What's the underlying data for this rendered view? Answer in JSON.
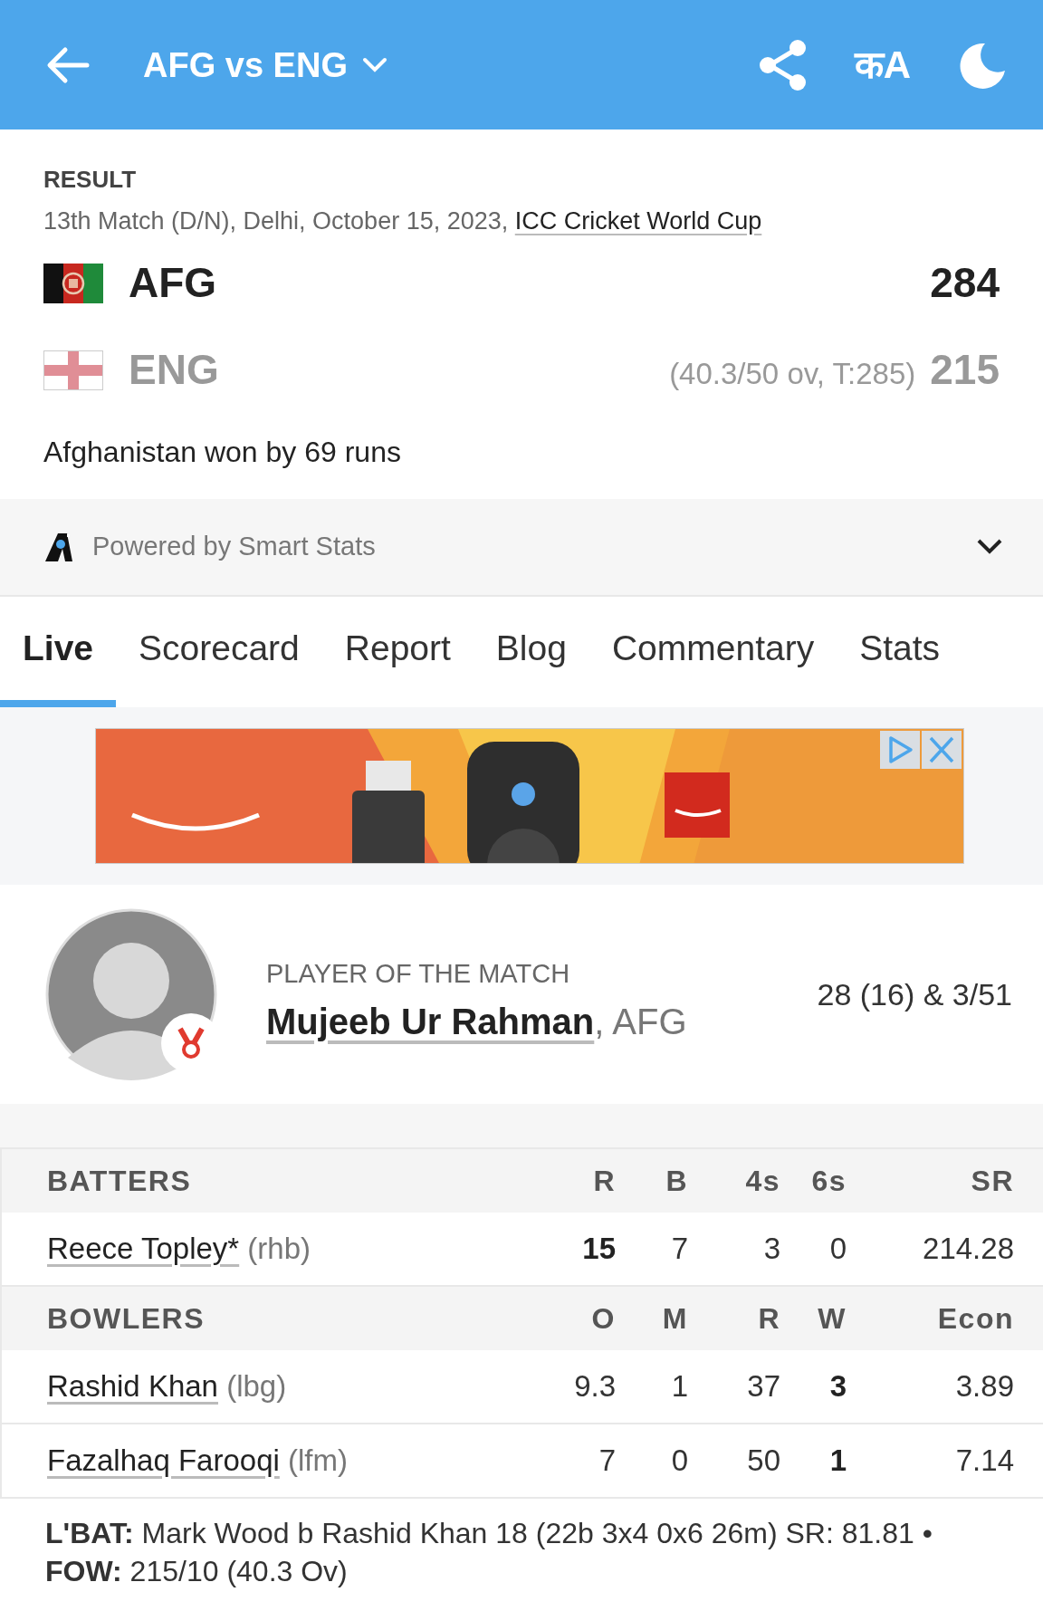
{
  "header": {
    "title": "AFG vs ENG",
    "language_toggle": "कA"
  },
  "result": {
    "status": "RESULT",
    "match_info": "13th Match (D/N), Delhi, October 15, 2023, ",
    "series_link": "ICC Cricket World Cup",
    "teams": [
      {
        "name": "AFG",
        "winner": true,
        "score": "284"
      },
      {
        "name": "ENG",
        "winner": false,
        "overs": "(40.3/50 ov, T:285)",
        "score": "215"
      }
    ],
    "summary": "Afghanistan won by 69 runs"
  },
  "smart_stats": {
    "label": "Powered by Smart Stats",
    "expanded": false
  },
  "tabs": [
    {
      "label": "Live",
      "selected": true
    },
    {
      "label": "Scorecard",
      "selected": false
    },
    {
      "label": "Report",
      "selected": false
    },
    {
      "label": "Blog",
      "selected": false
    },
    {
      "label": "Commentary",
      "selected": false
    },
    {
      "label": "Stats",
      "selected": false
    }
  ],
  "player_of_match": {
    "label": "PLAYER OF THE MATCH",
    "name": "Mujeeb Ur Rahman",
    "team": ", AFG",
    "figures": "28 (16) & 3/51"
  },
  "batters": {
    "columns": [
      "BATTERS",
      "R",
      "B",
      "4s",
      "6s",
      "SR"
    ],
    "rows": [
      {
        "cells": [
          {
            "text": "Reece Topley*",
            "note": " (rhb)",
            "bold": false
          },
          {
            "text": "15",
            "bold": true
          },
          {
            "text": "7",
            "bold": false
          },
          {
            "text": "3",
            "bold": false
          },
          {
            "text": "0",
            "bold": false
          },
          {
            "text": "214.28",
            "bold": false
          }
        ]
      }
    ]
  },
  "bowlers": {
    "columns": [
      "BOWLERS",
      "O",
      "M",
      "R",
      "W",
      "Econ"
    ],
    "rows": [
      {
        "cells": [
          {
            "text": "Rashid Khan",
            "note": " (lbg)",
            "bold": false
          },
          {
            "text": "9.3",
            "bold": false
          },
          {
            "text": "1",
            "bold": false
          },
          {
            "text": "37",
            "bold": false
          },
          {
            "text": "3",
            "bold": true
          },
          {
            "text": "3.89",
            "bold": false
          }
        ]
      },
      {
        "cells": [
          {
            "text": "Fazalhaq Farooqi",
            "note": " (lfm)",
            "bold": false
          },
          {
            "text": "7",
            "bold": false
          },
          {
            "text": "0",
            "bold": false
          },
          {
            "text": "50",
            "bold": false
          },
          {
            "text": "1",
            "bold": true
          },
          {
            "text": "7.14",
            "bold": false
          }
        ]
      }
    ]
  },
  "footer": "**L'BAT:** Mark Wood b Rashid Khan 18 (22b 3x4 0x6 26m) SR: 81.81 • **FOW:** 215/10 (40.3 Ov)"
}
